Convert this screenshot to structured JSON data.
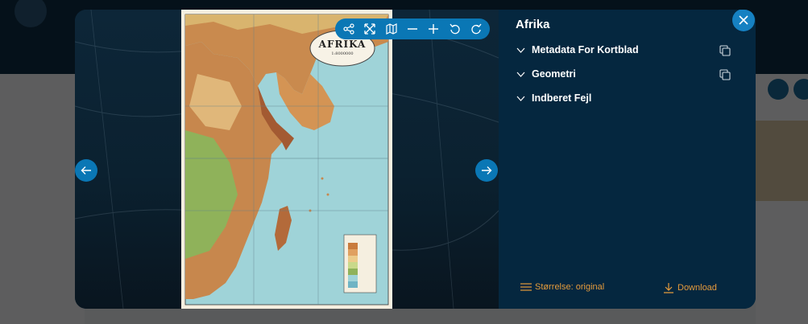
{
  "panel": {
    "title": "Afrika",
    "sections": [
      {
        "label": "Metadata For Kortblad",
        "copy": true
      },
      {
        "label": "Geometri",
        "copy": true
      },
      {
        "label": "Indberet Fejl",
        "copy": false
      }
    ],
    "size_label": "Størrelse: original",
    "download_label": "Download"
  },
  "map": {
    "title": "AFRIKA",
    "scale": "1:8000000"
  },
  "toolbar": {
    "icons": [
      "share-icon",
      "fullscreen-icon",
      "map-icon",
      "zoom-out-icon",
      "zoom-in-icon",
      "rotate-left-icon",
      "rotate-right-icon"
    ]
  },
  "colors": {
    "panel_bg": "#05273f",
    "accent_blue": "#0a77b5",
    "close_blue": "#1681c2",
    "footer_orange": "#e59b3c"
  }
}
